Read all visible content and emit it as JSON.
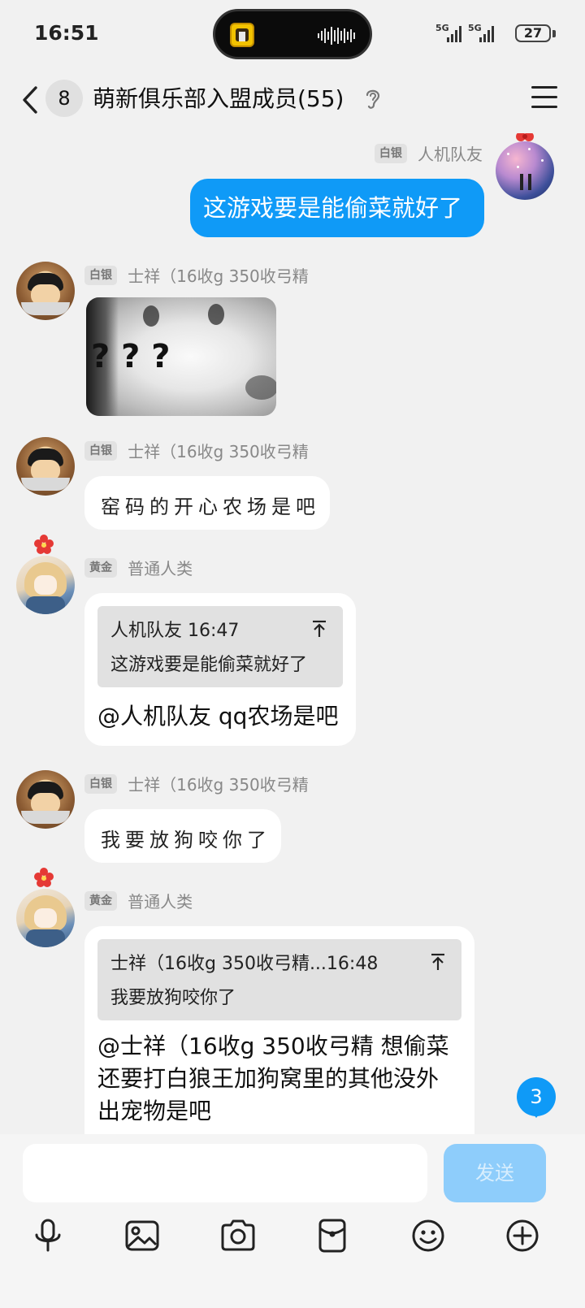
{
  "status_bar": {
    "time": "16:51",
    "network_1": "5G",
    "network_2": "5G",
    "battery": "27"
  },
  "header": {
    "unread_count": "8",
    "title": "萌新俱乐部入盟成员(55)",
    "icons": [
      "back-chevron-icon",
      "ear-icon",
      "menu-icon"
    ]
  },
  "messages": [
    {
      "side": "right",
      "badge": "白银",
      "nickname": "人机队友",
      "text": "这游戏要是能偷菜就好了"
    },
    {
      "side": "left",
      "badge": "白银",
      "nickname": "士祥（16收g 350收弓精",
      "sticker_text": "? ? ?"
    },
    {
      "side": "left",
      "badge": "白银",
      "nickname": "士祥（16收g 350收弓精",
      "text": "窑码的开心农场是吧"
    },
    {
      "side": "left",
      "badge": "黄金",
      "nickname": "普通人类",
      "quote_header": "人机队友 16:47",
      "quote_text": "这游戏要是能偷菜就好了",
      "text": "@人机队友 qq农场是吧"
    },
    {
      "side": "left",
      "badge": "白银",
      "nickname": "士祥（16收g 350收弓精",
      "text": "我要放狗咬你了"
    },
    {
      "side": "left",
      "badge": "黄金",
      "nickname": "普通人类",
      "quote_header": "士祥（16收g 350收弓精...16:48",
      "quote_text": "我要放狗咬你了",
      "text_lines": [
        "@士祥（16收g 350收弓精 想偷菜",
        "还要打白狼王加狗窝里的其他没外",
        "出宠物是吧"
      ]
    }
  ],
  "new_message_count": "3",
  "composer": {
    "input_value": "",
    "send_label": "发送",
    "tools": [
      "microphone-icon",
      "image-icon",
      "camera-icon",
      "red-packet-icon",
      "emoji-icon",
      "plus-icon"
    ]
  },
  "colors": {
    "accent": "#0f9af7",
    "background": "#f1f1f1",
    "bubble": "#ffffff",
    "send_disabled": "#8ecdfb"
  }
}
